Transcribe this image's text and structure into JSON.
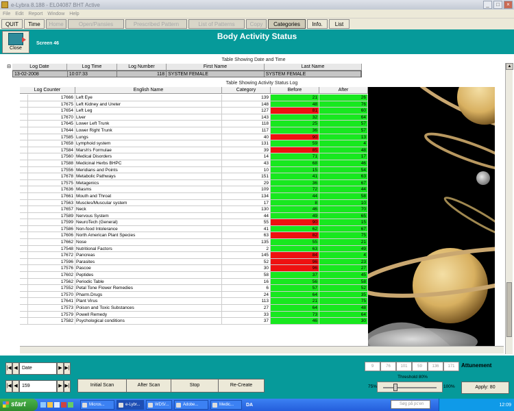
{
  "window": {
    "title": "e-Lybra 8.188 - EL04087 BHT Active"
  },
  "menu": [
    "File",
    "Edit",
    "Report",
    "Window",
    "Help"
  ],
  "toolbar": {
    "buttons": [
      "QUIT",
      "Time",
      "Home",
      "Open/Pansies",
      "Prescribed Pattern",
      "List of Patterns",
      "Copy",
      "Categories",
      "Info.",
      "List"
    ]
  },
  "header": {
    "title": "Body Activity Status",
    "close_label": "Close",
    "screen_label": "Screen 46"
  },
  "date_table": {
    "caption": "Table Showing Date and Time",
    "headers": [
      "Log Date",
      "Log Time",
      "Log Number",
      "First Name",
      "Last Name"
    ],
    "row": [
      "13-02-2008",
      "10:07:33",
      "118",
      "SYSTEM FEMALE",
      "SYSTEM FEMALE"
    ]
  },
  "status_table": {
    "caption": "Table Showing Activity Status Log",
    "headers": [
      "Log Counter",
      "English Name",
      "Category",
      "Before",
      "After"
    ],
    "rows": [
      [
        "17666",
        "Left Eye",
        "139",
        "21",
        "26",
        "g"
      ],
      [
        "17675",
        "Left Kidney and Ureter",
        "148",
        "48",
        "76",
        "g"
      ],
      [
        "17654",
        "Left Leg",
        "127",
        "81",
        "60",
        "r"
      ],
      [
        "17670",
        "Liver",
        "143",
        "32",
        "64",
        "g"
      ],
      [
        "17645",
        "Lower Left Trunk",
        "118",
        "25",
        "57",
        "g"
      ],
      [
        "17644",
        "Lower Right Trunk",
        "117",
        "36",
        "57",
        "g"
      ],
      [
        "17585",
        "Lungs",
        "40",
        "90",
        "13",
        "r"
      ],
      [
        "17658",
        "Lymphoid system",
        "131",
        "59",
        "4",
        "g"
      ],
      [
        "17584",
        "Marsh's Formulae",
        "39",
        "85",
        "48",
        "r"
      ],
      [
        "17560",
        "Medical Disorders",
        "14",
        "71",
        "17",
        "g"
      ],
      [
        "17588",
        "Medicinal Herbs BHPC",
        "43",
        "68",
        "46",
        "g"
      ],
      [
        "17556",
        "Meridians and Points",
        "10",
        "15",
        "54",
        "g"
      ],
      [
        "17678",
        "Metabolic Pathways",
        "151",
        "41",
        "63",
        "g"
      ],
      [
        "17575",
        "Metagenics",
        "29",
        "36",
        "67",
        "g"
      ],
      [
        "17636",
        "Miasms",
        "109",
        "72",
        "44",
        "g"
      ],
      [
        "17661",
        "Mouth and Throat",
        "134",
        "44",
        "58",
        "g"
      ],
      [
        "17563",
        "Muscles/Muscular system",
        "17",
        "8",
        "10",
        "g"
      ],
      [
        "17657",
        "Neck",
        "130",
        "46",
        "70",
        "g"
      ],
      [
        "17589",
        "Nervous System",
        "44",
        "49",
        "65",
        "g"
      ],
      [
        "17599",
        "NeuroTech (General)",
        "55",
        "90",
        "15",
        "r"
      ],
      [
        "17586",
        "Non-food Intolerance",
        "41",
        "62",
        "67",
        "g"
      ],
      [
        "17606",
        "North American Plant Species",
        "63",
        "82",
        "75",
        "r"
      ],
      [
        "17662",
        "Nose",
        "135",
        "55",
        "21",
        "g"
      ],
      [
        "17548",
        "Nutritional Factors",
        "2",
        "63",
        "49",
        "g"
      ],
      [
        "17672",
        "Pancreas",
        "145",
        "84",
        "4",
        "r"
      ],
      [
        "17596",
        "Parasites",
        "52",
        "96",
        "23",
        "r"
      ],
      [
        "17576",
        "Pascoe",
        "30",
        "96",
        "27",
        "r"
      ],
      [
        "17602",
        "Peptides",
        "58",
        "37",
        "45",
        "g"
      ],
      [
        "17562",
        "Periodic Table",
        "16",
        "56",
        "58",
        "g"
      ],
      [
        "17552",
        "Petal Tone Flower Remedies",
        "6",
        "57",
        "52",
        "g"
      ],
      [
        "17570",
        "Pharm.Drugs",
        "24",
        "64",
        "35",
        "g"
      ],
      [
        "17641",
        "Plant Virus",
        "113",
        "21",
        "75",
        "g"
      ],
      [
        "17573",
        "Poison and Toxic Substances",
        "27",
        "64",
        "48",
        "g"
      ],
      [
        "17579",
        "Powell Remedy",
        "33",
        "73",
        "64",
        "g"
      ],
      [
        "17582",
        "Psychological conditions",
        "37",
        "46",
        "30",
        "g"
      ]
    ]
  },
  "bottom": {
    "nav_date_label": "Date",
    "nav_num_label": "159",
    "buttons": [
      "Initial Scan",
      "After Scan",
      "Stop",
      "Re-Create"
    ],
    "attunement_label": "Attunement",
    "attunement_values": [
      "9",
      "76",
      "101",
      "59",
      "136",
      "171"
    ],
    "threshold_label": "Threshold 80%",
    "slider_min": "75%",
    "slider_max": "100%",
    "slider_level": 0.2,
    "apply_label": "Apply: 80"
  },
  "taskbar": {
    "start": "start",
    "tasks": [
      "Micros...",
      "e-Lybr...",
      "WDS/...",
      "Adobe...",
      "Medic..."
    ],
    "lang": "DA",
    "search_placeholder": "Søg på pc'en",
    "clock": "12:09"
  },
  "colors": {
    "teal": "#069a9a",
    "green": "#18e81f",
    "red": "#ee1111"
  }
}
